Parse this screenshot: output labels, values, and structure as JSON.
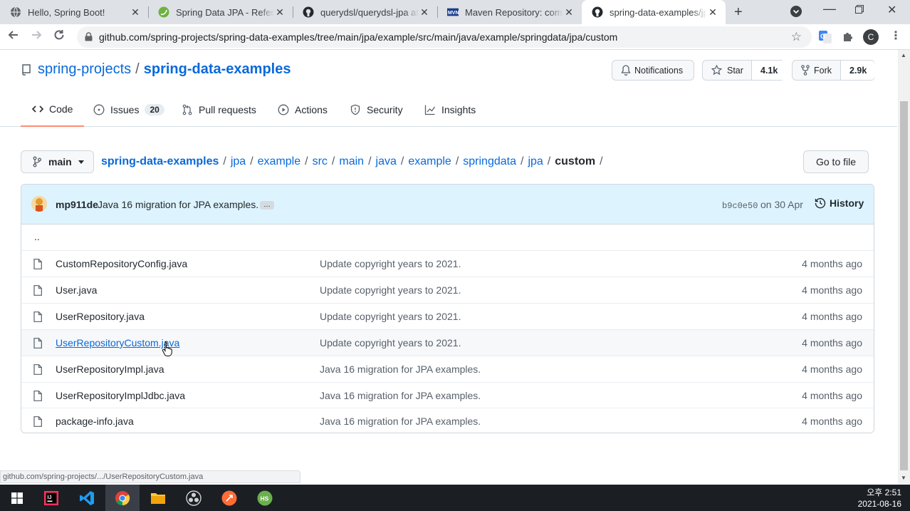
{
  "browser": {
    "tabs": [
      {
        "title": "Hello, Spring Boot!",
        "favicon": "globe-icon"
      },
      {
        "title": "Spring Data JPA - Reference",
        "favicon": "spring-icon"
      },
      {
        "title": "querydsl/querydsl-jpa at",
        "favicon": "github-icon"
      },
      {
        "title": "Maven Repository: com.q",
        "favicon": "maven-icon"
      },
      {
        "title": "spring-data-examples/jpa",
        "favicon": "github-icon",
        "active": true
      }
    ],
    "url": "github.com/spring-projects/spring-data-examples/tree/main/jpa/example/src/main/java/example/springdata/jpa/custom",
    "profile_initial": "C"
  },
  "repo": {
    "owner": "spring-projects",
    "separator": "/",
    "name": "spring-data-examples",
    "notifications_label": "Notifications",
    "star_label": "Star",
    "star_count": "4.1k",
    "fork_label": "Fork",
    "fork_count": "2.9k"
  },
  "nav": {
    "code": "Code",
    "issues": "Issues",
    "issues_count": "20",
    "pull_requests": "Pull requests",
    "actions": "Actions",
    "security": "Security",
    "insights": "Insights"
  },
  "path": {
    "branch": "main",
    "crumbs": [
      "spring-data-examples",
      "jpa",
      "example",
      "src",
      "main",
      "java",
      "example",
      "springdata",
      "jpa"
    ],
    "sep": "/",
    "current": "custom",
    "trailing": "/",
    "go_to_file": "Go to file"
  },
  "commit": {
    "author": "mp911de",
    "message": "Java 16 migration for JPA examples.",
    "ellipsis": "…",
    "sha": "b9c0e50",
    "date": "on 30 Apr",
    "history": "History"
  },
  "files": {
    "parent": "..",
    "rows": [
      {
        "name": "CustomRepositoryConfig.java",
        "message": "Update copyright years to 2021.",
        "age": "4 months ago"
      },
      {
        "name": "User.java",
        "message": "Update copyright years to 2021.",
        "age": "4 months ago"
      },
      {
        "name": "UserRepository.java",
        "message": "Update copyright years to 2021.",
        "age": "4 months ago"
      },
      {
        "name": "UserRepositoryCustom.java",
        "message": "Update copyright years to 2021.",
        "age": "4 months ago"
      },
      {
        "name": "UserRepositoryImpl.java",
        "message": "Java 16 migration for JPA examples.",
        "age": "4 months ago"
      },
      {
        "name": "UserRepositoryImplJdbc.java",
        "message": "Java 16 migration for JPA examples.",
        "age": "4 months ago"
      },
      {
        "name": "package-info.java",
        "message": "Java 16 migration for JPA examples.",
        "age": "4 months ago"
      }
    ]
  },
  "status_url": "github.com/spring-projects/.../UserRepositoryCustom.java",
  "taskbar": {
    "time": "오후 2:51",
    "date": "2021-08-16"
  }
}
